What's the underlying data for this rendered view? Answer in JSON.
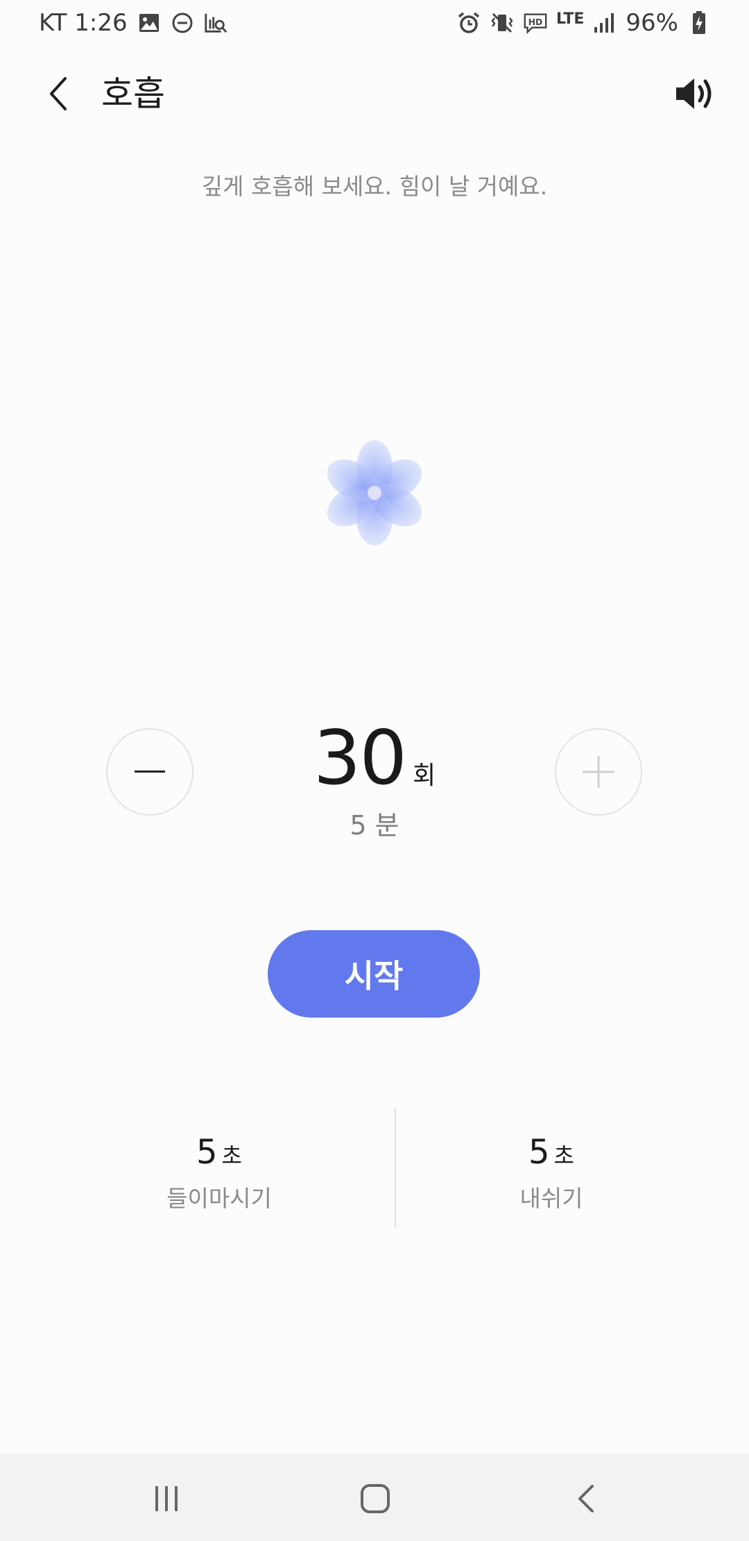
{
  "status_bar": {
    "carrier_time": "KT 1:26",
    "network": "LTE",
    "battery": "96%",
    "left_icons": [
      "gallery-icon",
      "do-not-disturb-icon",
      "screen-search-icon"
    ],
    "right_icons": [
      "alarm-icon",
      "vibrate-off-icon",
      "hd-voice-icon",
      "lte-icon",
      "signal-icon",
      "battery-charging-icon"
    ]
  },
  "header": {
    "title": "호흡",
    "back_icon": "chevron-left-icon",
    "sound_icon": "speaker-icon"
  },
  "subtitle": "깊게 호흡해 보세요. 힘이 날 거예요.",
  "breathing": {
    "count": "30",
    "count_unit": "회",
    "duration": "5 분",
    "start_label": "시작"
  },
  "stats": {
    "inhale": {
      "value": "5",
      "unit": "초",
      "label": "들이마시기"
    },
    "exhale": {
      "value": "5",
      "unit": "초",
      "label": "내쉬기"
    }
  },
  "nav": {
    "recents_icon": "recent-apps-icon",
    "home_icon": "home-icon",
    "back_icon": "back-icon"
  },
  "colors": {
    "accent": "#6279ee",
    "background": "#fcfcfc",
    "nav_bar": "#f2f2f2"
  }
}
